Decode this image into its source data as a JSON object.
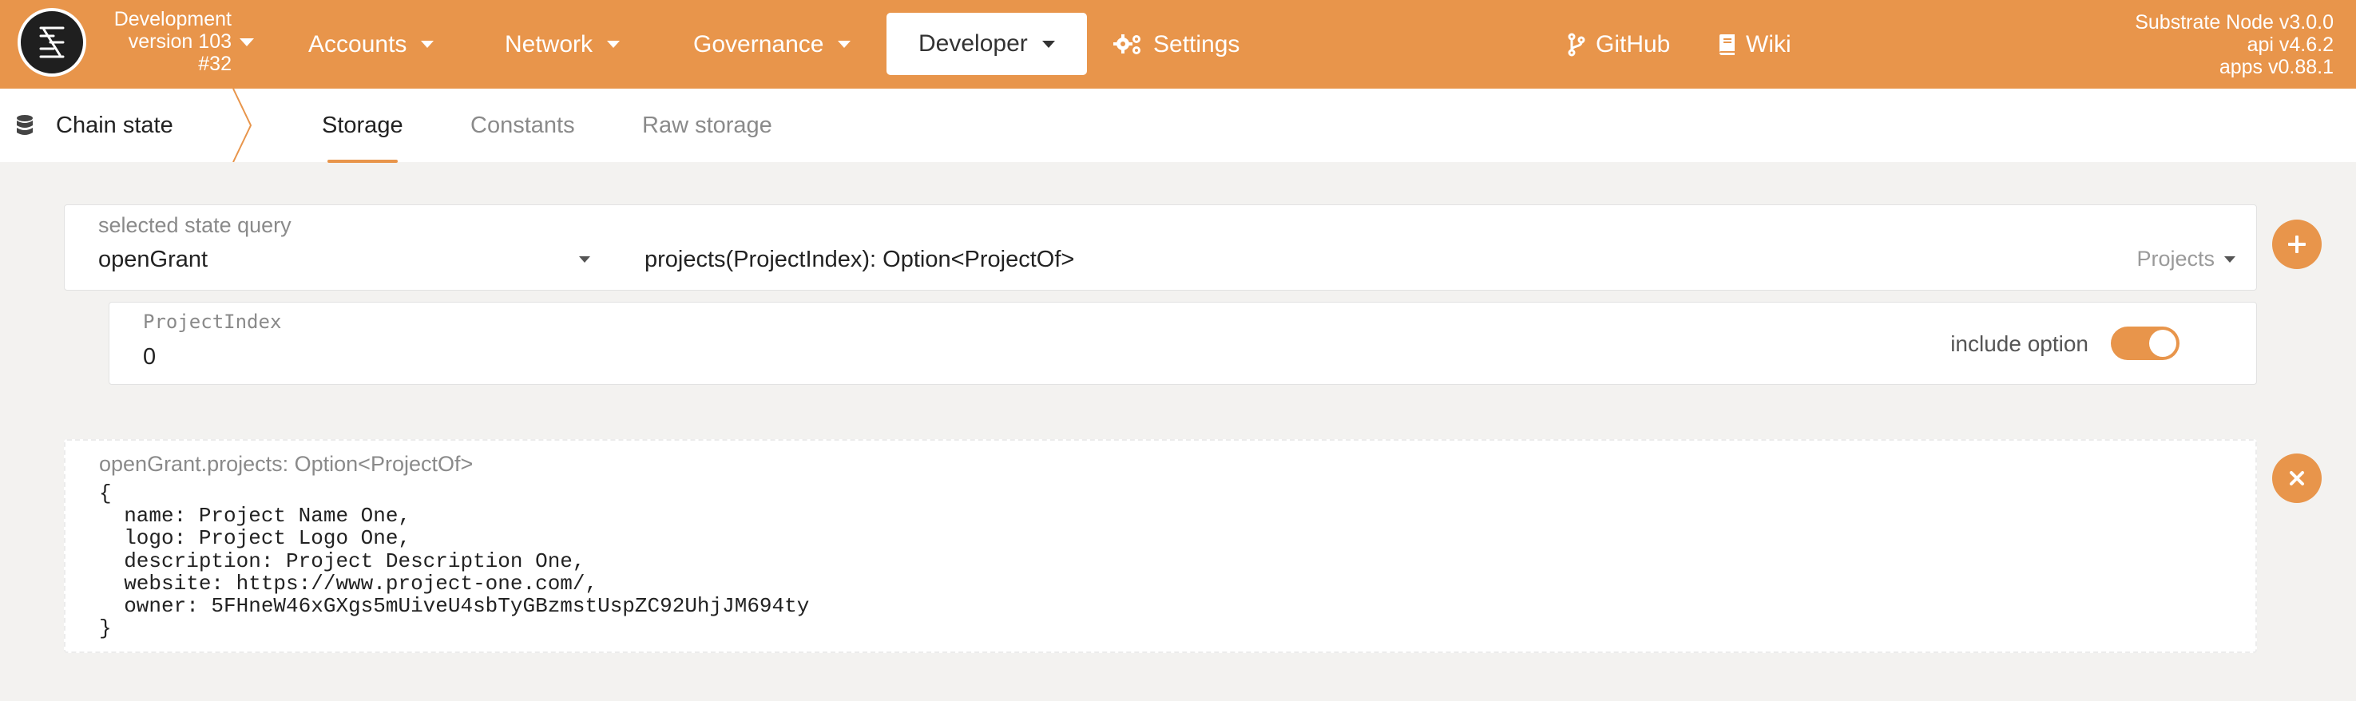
{
  "topbar": {
    "chain": {
      "name": "Development",
      "version": "version 103",
      "block": "#32"
    },
    "menu": [
      {
        "label": "Accounts"
      },
      {
        "label": "Network"
      },
      {
        "label": "Governance"
      },
      {
        "label": "Developer",
        "active": true
      },
      {
        "label": "Settings"
      }
    ],
    "links": [
      {
        "label": "GitHub",
        "icon": "git-branch-icon"
      },
      {
        "label": "Wiki",
        "icon": "book-icon"
      }
    ],
    "versions": {
      "node": "Substrate Node v3.0.0",
      "api": "api v4.6.2",
      "apps": "apps v0.88.1"
    },
    "accent_color": "#e8954b"
  },
  "subnav": {
    "section": "Chain state",
    "section_icon": "database-icon",
    "tabs": [
      {
        "label": "Storage",
        "active": true
      },
      {
        "label": "Constants"
      },
      {
        "label": "Raw storage"
      }
    ]
  },
  "query": {
    "label": "selected state query",
    "section": "openGrant",
    "method": "projects(ProjectIndex): Option<ProjectOf>",
    "method_doc": "Projects",
    "add_icon": "plus-icon"
  },
  "param": {
    "label": "ProjectIndex",
    "value": "0",
    "include_option_label": "include option",
    "include_option": true
  },
  "result": {
    "label": "openGrant.projects: Option<ProjectOf>",
    "value": "{\n  name: Project Name One,\n  logo: Project Logo One,\n  description: Project Description One,\n  website: https://www.project-one.com/,\n  owner: 5FHneW46xGXgs5mUiveU4sbTyGBzmstUspZC92UhjJM694ty\n}",
    "close_icon": "close-icon"
  }
}
